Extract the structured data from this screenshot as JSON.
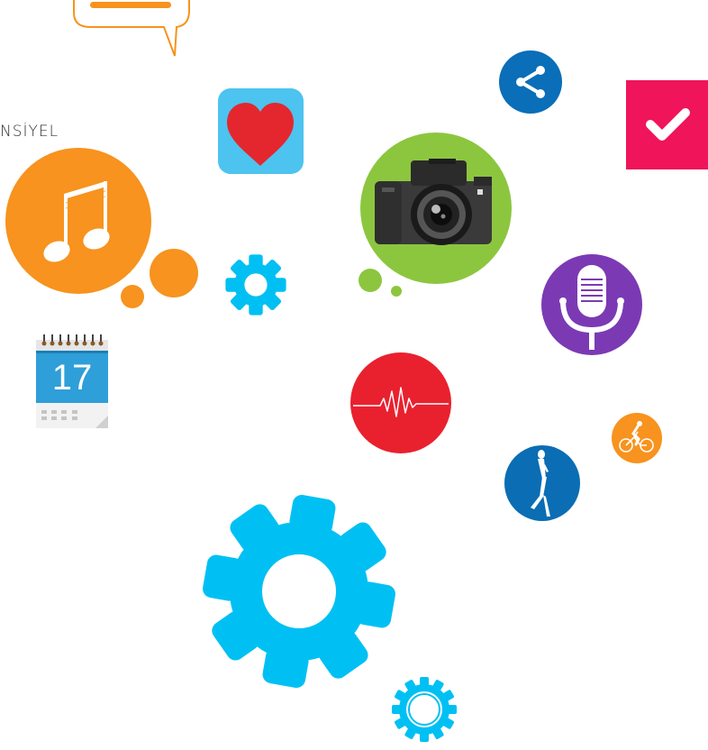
{
  "labels": {
    "partial_text": "NSİYEL",
    "calendar_day": "17"
  },
  "icons": {
    "speech_bubble": "speech-bubble-icon",
    "share": "share-icon",
    "checkmark": "checkmark-icon",
    "heart": "heart-icon",
    "music": "music-note-icon",
    "gear_small": "gear-icon",
    "camera": "camera-icon",
    "microphone": "microphone-icon",
    "calendar": "calendar-icon",
    "heartbeat": "heartbeat-icon",
    "cyclist": "cyclist-icon",
    "walker": "walking-person-icon",
    "gear_large": "gear-icon",
    "gear_tiny": "gear-icon"
  },
  "colors": {
    "orange": "#F7931E",
    "share_blue": "#0A6EB8",
    "check_red": "#F0145A",
    "heart_bg": "#4DC3F0",
    "heart_red": "#E4272E",
    "gear_cyan": "#00C0F3",
    "camera_green": "#8CC63F",
    "mic_purple": "#7B3AB3",
    "pulse_red": "#E9212E",
    "walker_blue": "#0B6DB3",
    "calendar_blue": "#2E9FD8"
  }
}
